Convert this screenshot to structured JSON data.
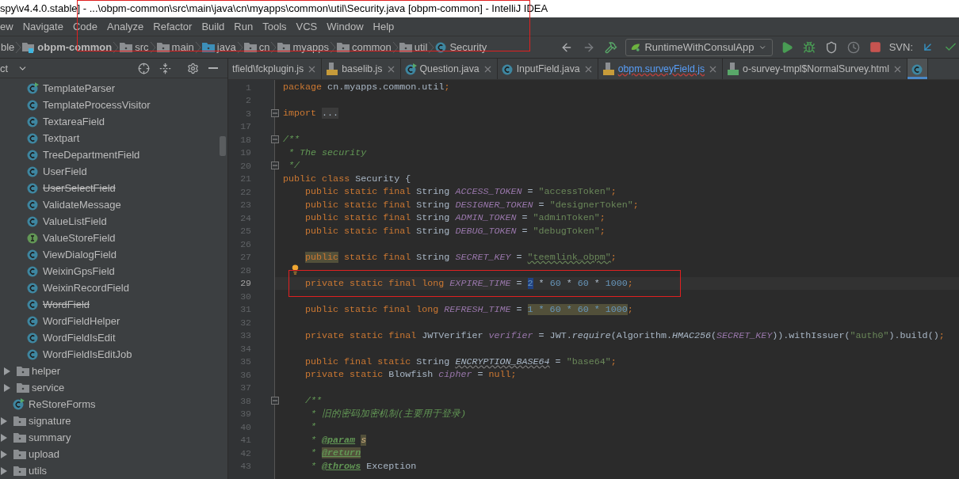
{
  "window": {
    "title": "spy\\v4.4.0.stable] - ...\\obpm-common\\src\\main\\java\\cn\\myapps\\common\\util\\Security.java [obpm-common] - IntelliJ IDEA"
  },
  "menu": [
    "ew",
    "Navigate",
    "Code",
    "Analyze",
    "Refactor",
    "Build",
    "Run",
    "Tools",
    "VCS",
    "Window",
    "Help"
  ],
  "breadcrumb": {
    "annotated": true,
    "items": [
      {
        "label": "ble",
        "kind": "none"
      },
      {
        "label": "obpm-common",
        "kind": "module"
      },
      {
        "label": "src",
        "kind": "folder"
      },
      {
        "label": "main",
        "kind": "folder"
      },
      {
        "label": "java",
        "kind": "source"
      },
      {
        "label": "cn",
        "kind": "package"
      },
      {
        "label": "myapps",
        "kind": "package"
      },
      {
        "label": "common",
        "kind": "package"
      },
      {
        "label": "util",
        "kind": "package"
      },
      {
        "label": "Security",
        "kind": "class"
      }
    ]
  },
  "toolbar": {
    "run_config": "RuntimeWithConsulApp",
    "vcs_label": "SVN:"
  },
  "project_panel": {
    "title": "ct"
  },
  "tabs": [
    {
      "label": "tfield\\fckplugin.js",
      "kind": "plain",
      "selected": false,
      "error": false
    },
    {
      "label": "baselib.js",
      "kind": "js",
      "selected": false,
      "error": false
    },
    {
      "label": "Question.java",
      "kind": "runnable",
      "selected": false,
      "error": false
    },
    {
      "label": "InputField.java",
      "kind": "class",
      "selected": false,
      "error": false
    },
    {
      "label": "obpm.surveyField.js",
      "kind": "js",
      "selected": false,
      "error": true
    },
    {
      "label": "o-survey-tmpl$NormalSurvey.html",
      "kind": "html",
      "selected": false,
      "error": false
    },
    {
      "kind": "class",
      "selected": true
    }
  ],
  "tree": [
    {
      "children": [
        {
          "children": [
            {
              "label": "TemplateParser",
              "kind": "runnable",
              "deprecated": false
            },
            {
              "label": "TemplateProcessVisitor",
              "kind": "class",
              "deprecated": false
            },
            {
              "label": "TextareaField",
              "kind": "class",
              "deprecated": false
            },
            {
              "label": "Textpart",
              "kind": "class",
              "deprecated": false
            },
            {
              "label": "TreeDepartmentField",
              "kind": "class",
              "deprecated": false
            },
            {
              "label": "UserField",
              "kind": "class",
              "deprecated": false
            },
            {
              "label": "UserSelectField",
              "kind": "class",
              "deprecated": true
            },
            {
              "label": "ValidateMessage",
              "kind": "class",
              "deprecated": false
            },
            {
              "label": "ValueListField",
              "kind": "class",
              "deprecated": false
            },
            {
              "label": "ValueStoreField",
              "kind": "interface",
              "deprecated": false
            },
            {
              "label": "ViewDialogField",
              "kind": "class",
              "deprecated": false
            },
            {
              "label": "WeixinGpsField",
              "kind": "class",
              "deprecated": false
            },
            {
              "label": "WeixinRecordField",
              "kind": "class",
              "deprecated": false
            },
            {
              "label": "WordField",
              "kind": "class",
              "deprecated": true
            },
            {
              "label": "WordFieldHelper",
              "kind": "class",
              "deprecated": false
            },
            {
              "label": "WordFieldIsEdit",
              "kind": "class",
              "deprecated": false
            },
            {
              "label": "WordFieldIsEditJob",
              "kind": "class",
              "deprecated": false
            }
          ]
        },
        {
          "label": "helper",
          "kind": "folder",
          "expanded": false
        },
        {
          "label": "service",
          "kind": "folder",
          "expanded": false
        },
        {
          "label": "ReStoreForms",
          "kind": "runnable",
          "deprecated": false
        }
      ]
    },
    {
      "label": "signature",
      "kind": "folder",
      "expanded": false
    },
    {
      "label": "summary",
      "kind": "folder",
      "expanded": false
    },
    {
      "label": "upload",
      "kind": "folder",
      "expanded": false
    },
    {
      "label": "utils",
      "kind": "folder",
      "expanded": false
    }
  ],
  "code": [
    {
      "n": "1",
      "kind": "top",
      "tokens": [
        {
          "kind": "keyword",
          "t": "package"
        },
        {
          "kind": "plain",
          "t": " cn.myapps.common.util"
        },
        {
          "kind": "keyword",
          "t": ";"
        }
      ]
    },
    {
      "n": "2",
      "kind": "top"
    },
    {
      "n": "3",
      "kind": "top",
      "fold": true,
      "tokens": [
        {
          "kind": "keyword",
          "t": "import"
        },
        {
          "kind": "folded",
          "t": "..."
        }
      ]
    },
    {
      "n": "17",
      "kind": "top"
    },
    {
      "n": "18",
      "kind": "top",
      "fold": true,
      "tokens": [
        {
          "kind": "comment",
          "t": "/**"
        }
      ]
    },
    {
      "n": "19",
      "kind": "top",
      "tokens": [
        {
          "kind": "comment",
          "t": " * The security"
        }
      ]
    },
    {
      "n": "20",
      "kind": "top",
      "fold": true,
      "tokens": [
        {
          "kind": "comment",
          "t": " */"
        }
      ]
    },
    {
      "n": "21",
      "kind": "top",
      "tokens": [
        {
          "kind": "keyword",
          "t": "public class"
        },
        {
          "kind": "plain",
          "t": " Security {"
        }
      ]
    },
    {
      "n": "22",
      "kind": "member",
      "tokens": [
        {
          "kind": "keyword",
          "t": "public static final"
        },
        {
          "kind": "plain",
          "t": " String "
        },
        {
          "kind": "constant",
          "t": "ACCESS_TOKEN"
        },
        {
          "kind": "plain",
          "t": " = "
        },
        {
          "kind": "string",
          "t": "\"accessToken\""
        },
        {
          "kind": "keyword",
          "t": ";"
        }
      ]
    },
    {
      "n": "23",
      "kind": "member",
      "tokens": [
        {
          "kind": "keyword",
          "t": "public static final"
        },
        {
          "kind": "plain",
          "t": " String "
        },
        {
          "kind": "constant",
          "t": "DESIGNER_TOKEN"
        },
        {
          "kind": "plain",
          "t": " = "
        },
        {
          "kind": "string",
          "t": "\"designerToken\""
        },
        {
          "kind": "keyword",
          "t": ";"
        }
      ]
    },
    {
      "n": "24",
      "kind": "member",
      "tokens": [
        {
          "kind": "keyword",
          "t": "public static final"
        },
        {
          "kind": "plain",
          "t": " String "
        },
        {
          "kind": "constant",
          "t": "ADMIN_TOKEN"
        },
        {
          "kind": "plain",
          "t": " = "
        },
        {
          "kind": "string",
          "t": "\"adminToken\""
        },
        {
          "kind": "keyword",
          "t": ";"
        }
      ]
    },
    {
      "n": "25",
      "kind": "member",
      "tokens": [
        {
          "kind": "keyword",
          "t": "public static final"
        },
        {
          "kind": "plain",
          "t": " String "
        },
        {
          "kind": "constant",
          "t": "DEBUG_TOKEN"
        },
        {
          "kind": "plain",
          "t": " = "
        },
        {
          "kind": "string",
          "t": "\"debugToken\""
        },
        {
          "kind": "keyword",
          "t": ";"
        }
      ]
    },
    {
      "n": "26",
      "kind": "member"
    },
    {
      "n": "27",
      "kind": "member",
      "tokens": [
        {
          "kind": "keyword",
          "t": "public",
          "highlighted": true
        },
        {
          "kind": "keyword",
          "t": " static final"
        },
        {
          "kind": "plain",
          "t": " String "
        },
        {
          "kind": "constant",
          "t": "SECRET_KEY"
        },
        {
          "kind": "plain",
          "t": " = "
        },
        {
          "kind": "string",
          "t": "\"teemlink_obpm\"",
          "wavy": true
        },
        {
          "kind": "keyword",
          "t": ";"
        }
      ]
    },
    {
      "n": "28",
      "kind": "member",
      "bulb": true
    },
    {
      "n": "29",
      "kind": "member",
      "current": true,
      "annotated": true,
      "tokens": [
        {
          "kind": "keyword",
          "t": "private static final long "
        },
        {
          "kind": "constant",
          "t": "EXPIRE_TIME"
        },
        {
          "kind": "plain",
          "t": " = "
        },
        {
          "kind": "number",
          "t": "2",
          "selected": true
        },
        {
          "kind": "plain",
          "t": " * "
        },
        {
          "kind": "number",
          "t": "60"
        },
        {
          "kind": "plain",
          "t": " * "
        },
        {
          "kind": "number",
          "t": "60"
        },
        {
          "kind": "plain",
          "t": " * "
        },
        {
          "kind": "number",
          "t": "1000"
        },
        {
          "kind": "keyword",
          "t": ";"
        }
      ]
    },
    {
      "n": "30",
      "kind": "member"
    },
    {
      "n": "31",
      "kind": "member",
      "tokens": [
        {
          "kind": "keyword",
          "t": "public static final long "
        },
        {
          "kind": "constant",
          "t": "REFRESH_TIME"
        },
        {
          "kind": "plain",
          "t": " = "
        },
        {
          "kind": "number",
          "t": "1 * 60 * 60 * 1000",
          "highlighted": true
        },
        {
          "kind": "keyword",
          "t": ";"
        }
      ]
    },
    {
      "n": "32",
      "kind": "member"
    },
    {
      "n": "33",
      "kind": "member",
      "tokens": [
        {
          "kind": "keyword",
          "t": "private static final"
        },
        {
          "kind": "plain",
          "t": " JWTVerifier "
        },
        {
          "kind": "constant",
          "t": "verifier"
        },
        {
          "kind": "plain",
          "t": " = JWT."
        },
        {
          "kind": "static",
          "t": "require"
        },
        {
          "kind": "plain",
          "t": "(Algorithm."
        },
        {
          "kind": "static",
          "t": "HMAC256"
        },
        {
          "kind": "plain",
          "t": "("
        },
        {
          "kind": "constant",
          "t": "SECRET_KEY"
        },
        {
          "kind": "plain",
          "t": ")).withIssuer("
        },
        {
          "kind": "string",
          "t": "\"auth0\""
        },
        {
          "kind": "plain",
          "t": ").build()"
        },
        {
          "kind": "keyword",
          "t": ";"
        }
      ]
    },
    {
      "n": "34",
      "kind": "member"
    },
    {
      "n": "35",
      "kind": "member",
      "tokens": [
        {
          "kind": "keyword",
          "t": "public final static"
        },
        {
          "kind": "plain",
          "t": " String "
        },
        {
          "kind": "unused",
          "t": "ENCRYPTION_BASE64"
        },
        {
          "kind": "plain",
          "t": " = "
        },
        {
          "kind": "string",
          "t": "\"base64\""
        },
        {
          "kind": "keyword",
          "t": ";"
        }
      ]
    },
    {
      "n": "36",
      "kind": "member",
      "tokens": [
        {
          "kind": "keyword",
          "t": "private static"
        },
        {
          "kind": "plain",
          "t": " Blowfish "
        },
        {
          "kind": "constant",
          "t": "cipher"
        },
        {
          "kind": "plain",
          "t": " = "
        },
        {
          "kind": "keyword",
          "t": "null;"
        }
      ]
    },
    {
      "n": "37",
      "kind": "member"
    },
    {
      "n": "38",
      "kind": "member",
      "fold": true,
      "tokens": [
        {
          "kind": "comment",
          "t": "/**"
        }
      ]
    },
    {
      "n": "39",
      "kind": "member",
      "tokens": [
        {
          "kind": "comment",
          "t": " * 旧的密码加密机制(主要用于登录)"
        }
      ]
    },
    {
      "n": "40",
      "kind": "member",
      "tokens": [
        {
          "kind": "comment",
          "t": " *"
        }
      ]
    },
    {
      "n": "41",
      "kind": "member",
      "tokens": [
        {
          "kind": "comment",
          "t": " * "
        },
        {
          "kind": "tag",
          "t": "@param"
        },
        {
          "kind": "param",
          "t": "s",
          "highlighted": true
        }
      ]
    },
    {
      "n": "42",
      "kind": "member",
      "tokens": [
        {
          "kind": "comment",
          "t": " * "
        },
        {
          "kind": "tag",
          "t": "@return",
          "highlighted": true
        }
      ]
    },
    {
      "n": "43",
      "kind": "member",
      "tokens": [
        {
          "kind": "comment",
          "t": " * "
        },
        {
          "kind": "tag",
          "t": "@throws"
        },
        {
          "kind": "plain",
          "t": " Exception"
        }
      ]
    }
  ]
}
